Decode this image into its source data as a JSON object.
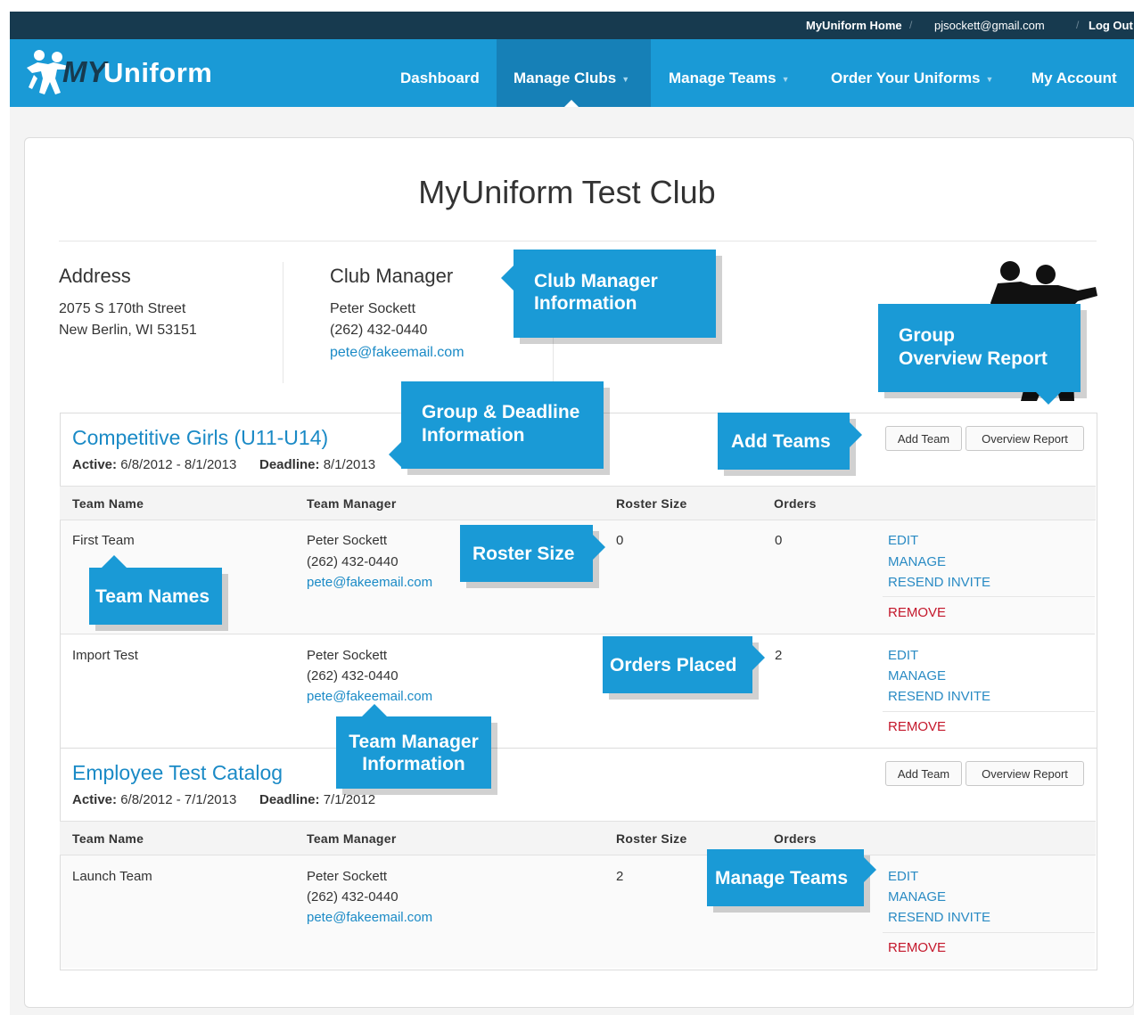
{
  "topbar": {
    "home_link": "MyUniform Home",
    "email_link": "pjsockett@gmail.com",
    "logout_link": "Log Out"
  },
  "logo": {
    "my": "MY",
    "uniform": "Uniform"
  },
  "nav": {
    "dashboard": "Dashboard",
    "manage_clubs": "Manage Clubs",
    "manage_teams": "Manage Teams",
    "order_uniforms": "Order Your Uniforms",
    "my_account": "My Account"
  },
  "club": {
    "title": "MyUniform Test Club",
    "address_heading": "Address",
    "address_line1": "2075 S 170th Street",
    "address_line2": "New Berlin, WI 53151",
    "manager_heading": "Club Manager",
    "manager_name": "Peter Sockett",
    "manager_phone": "(262) 432-0440",
    "manager_email": "pete@fakeemail.com"
  },
  "table_headers": {
    "team_name": "Team Name",
    "team_manager": "Team Manager",
    "roster_size": "Roster Size",
    "orders": "Orders"
  },
  "actions": {
    "edit": "EDIT",
    "manage": "MANAGE",
    "resend": "RESEND INVITE",
    "remove": "REMOVE",
    "add_team": "Add Team",
    "overview_report": "Overview Report"
  },
  "groups": [
    {
      "title": "Competitive Girls (U11-U14)",
      "active_label": "Active:",
      "active_value": "6/8/2012 - 8/1/2013",
      "deadline_label": "Deadline:",
      "deadline_value": "8/1/2013",
      "teams": [
        {
          "name": "First Team",
          "manager_name": "Peter Sockett",
          "manager_phone": "(262) 432-0440",
          "manager_email": "pete@fakeemail.com",
          "roster": "0",
          "orders": "0"
        },
        {
          "name": "Import Test",
          "manager_name": "Peter Sockett",
          "manager_phone": "(262) 432-0440",
          "manager_email": "pete@fakeemail.com",
          "roster": "",
          "orders": "2"
        }
      ]
    },
    {
      "title": "Employee Test Catalog",
      "active_label": "Active:",
      "active_value": "6/8/2012 - 7/1/2013",
      "deadline_label": "Deadline:",
      "deadline_value": "7/1/2012",
      "teams": [
        {
          "name": "Launch Team",
          "manager_name": "Peter Sockett",
          "manager_phone": "(262) 432-0440",
          "manager_email": "pete@fakeemail.com",
          "roster": "2",
          "orders": ""
        }
      ]
    }
  ],
  "callouts": {
    "club_manager_1": "Club Manager",
    "club_manager_2": "Information",
    "group_overview_1": "Group",
    "group_overview_2": "Overview Report",
    "group_deadline_1": "Group & Deadline",
    "group_deadline_2": "Information",
    "add_teams": "Add Teams",
    "roster_size": "Roster Size",
    "team_names": "Team Names",
    "orders_placed": "Orders Placed",
    "team_manager_1": "Team Manager",
    "team_manager_2": "Information",
    "manage_teams": "Manage Teams"
  },
  "colors": {
    "brand_blue": "#1a9ad6",
    "topbar_navy": "#173a4f",
    "link_blue": "#1a8ac6",
    "remove_red": "#c4172b"
  }
}
